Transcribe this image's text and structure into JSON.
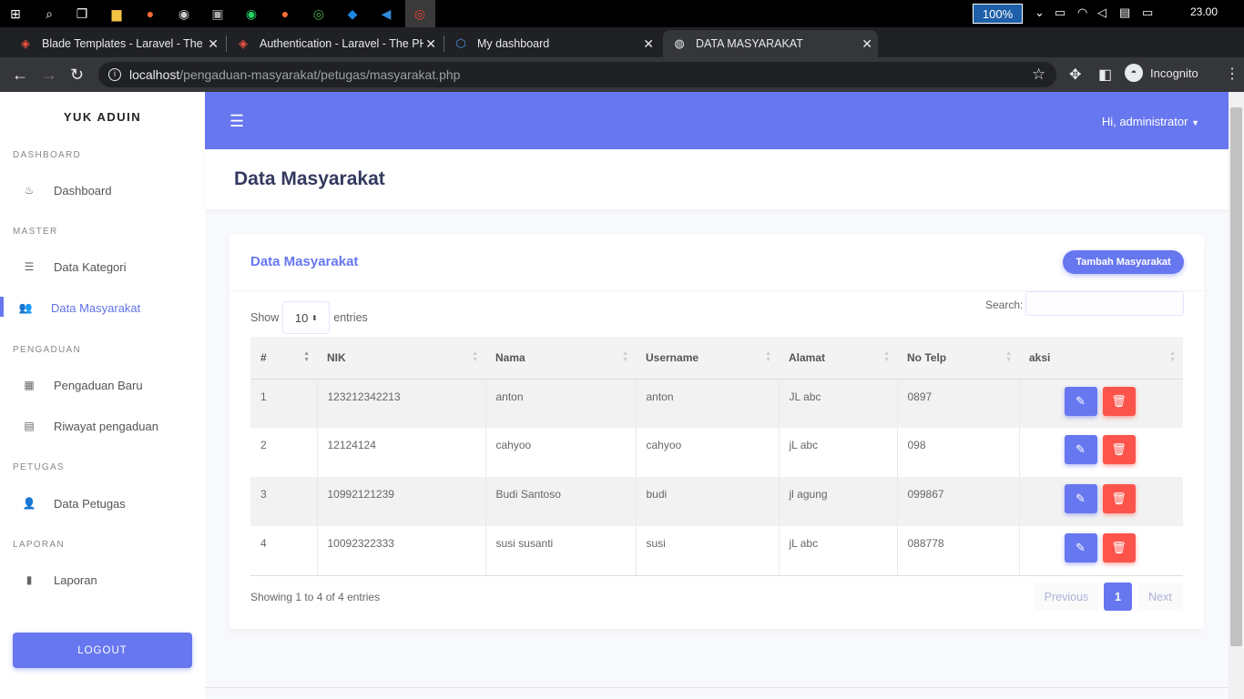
{
  "taskbar": {
    "zoom": "100%",
    "clock": "23.00"
  },
  "tabs": [
    {
      "title": "Blade Templates - Laravel - The P"
    },
    {
      "title": "Authentication - Laravel - The PH"
    },
    {
      "title": "My dashboard"
    },
    {
      "title": "DATA MASYARAKAT"
    }
  ],
  "browser": {
    "url_host": "localhost",
    "url_path": "/pengaduan-masyarakat/petugas/masyarakat.php",
    "incognito": "Incognito"
  },
  "sidebar": {
    "brand": "YUK ADUIN",
    "sections": {
      "dashboard": "DASHBOARD",
      "master": "MASTER",
      "pengaduan": "PENGADUAN",
      "petugas": "PETUGAS",
      "laporan": "LAPORAN"
    },
    "items": {
      "dashboard": "Dashboard",
      "kategori": "Data Kategori",
      "masyarakat": "Data Masyarakat",
      "baru": "Pengaduan Baru",
      "riwayat": "Riwayat pengaduan",
      "petugas": "Data Petugas",
      "laporan": "Laporan"
    },
    "logout": "LOGOUT"
  },
  "topnav": {
    "user": "Hi, administrator"
  },
  "page": {
    "title": "Data Masyarakat"
  },
  "card": {
    "title": "Data Masyarakat",
    "add_button": "Tambah Masyarakat",
    "show_label": "Show",
    "entries_value": "10",
    "entries_label": "entries",
    "search_label": "Search:",
    "columns": [
      "#",
      "NIK",
      "Nama",
      "Username",
      "Alamat",
      "No Telp",
      "aksi"
    ],
    "rows": [
      [
        "1",
        "123212342213",
        "anton",
        "anton",
        "JL abc",
        "0897"
      ],
      [
        "2",
        "12124124",
        "cahyoo",
        "cahyoo",
        "jL abc",
        "098"
      ],
      [
        "3",
        "10992121239",
        "Budi Santoso",
        "budi",
        "jl agung",
        "099867"
      ],
      [
        "4",
        "10092322333",
        "susi susanti",
        "susi",
        "jL abc",
        "088778"
      ]
    ],
    "info": "Showing 1 to 4 of 4 entries",
    "pagination": {
      "prev": "Previous",
      "current": "1",
      "next": "Next"
    }
  },
  "colors": {
    "primary": "#6777ef",
    "danger": "#fc544b"
  }
}
